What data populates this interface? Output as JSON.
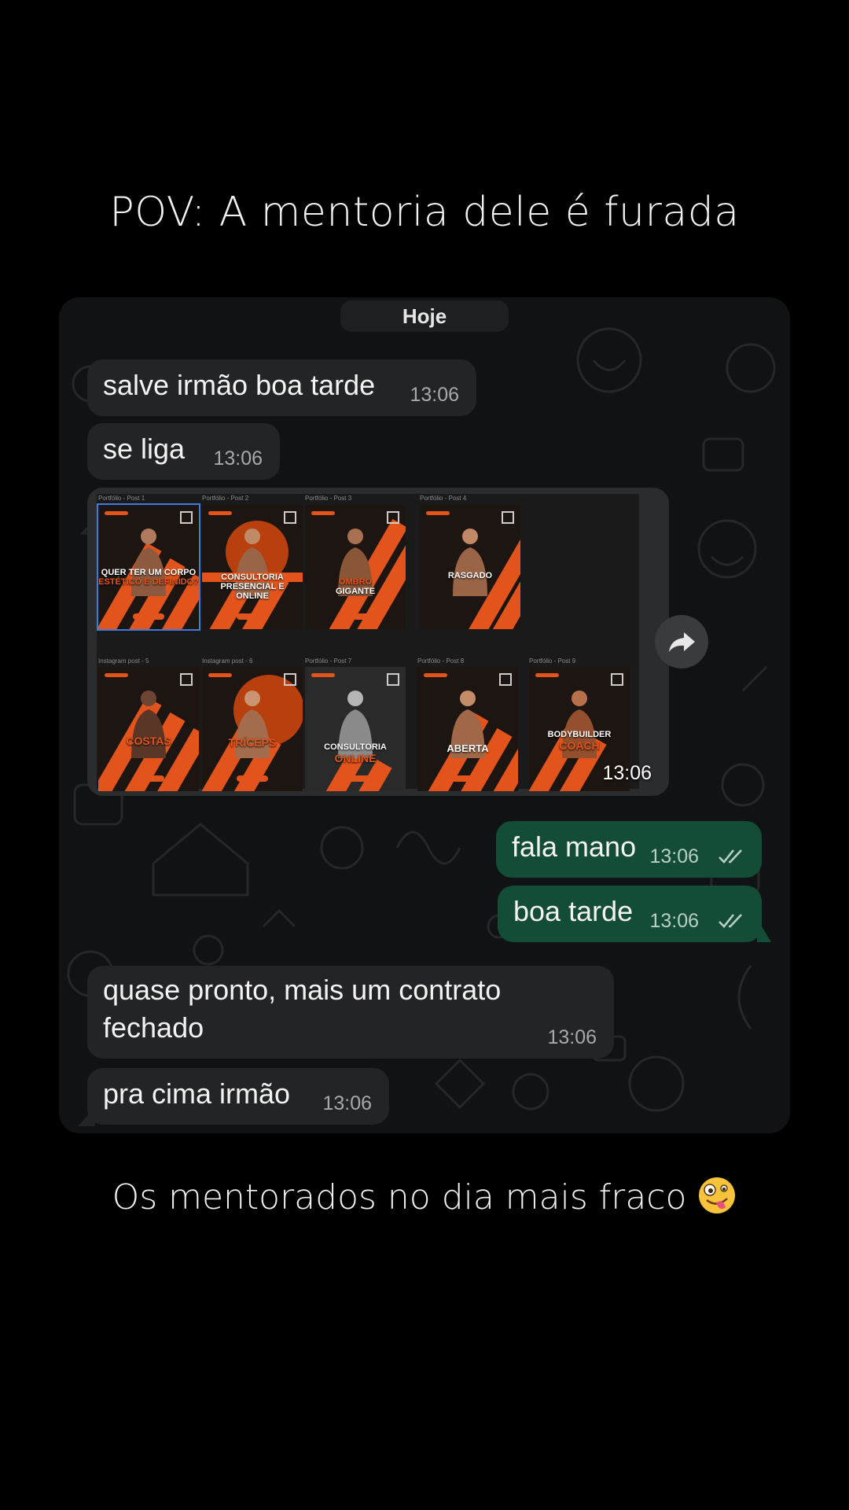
{
  "captions": {
    "top": "POV: A mentoria dele é furada",
    "bottom": "Os mentorados no dia mais fraco"
  },
  "chat": {
    "day_label": "Hoje",
    "messages": [
      {
        "direction": "in",
        "text": "salve irmão boa tarde",
        "time": "13:06"
      },
      {
        "direction": "in",
        "text": "se liga",
        "time": "13:06"
      },
      {
        "direction": "in",
        "type": "image",
        "time": "13:06"
      },
      {
        "direction": "out",
        "text": "fala mano",
        "time": "13:06",
        "status": "read"
      },
      {
        "direction": "out",
        "text": "boa tarde",
        "time": "13:06",
        "status": "read"
      },
      {
        "direction": "in",
        "text_line1": "quase pronto, mais um contrato",
        "text_line2": "fechado",
        "time": "13:06"
      },
      {
        "direction": "in",
        "text": "pra cima irmão",
        "time": "13:06"
      }
    ],
    "image": {
      "posts": [
        {
          "label": "Portfólio - Post 1",
          "title_line1": "QUER TER UM CORPO",
          "title_line2": "ESTÉTICO E DEFINIDO?"
        },
        {
          "label": "Portfólio - Post 2",
          "title_line1": "CONSULTORIA",
          "title_line2": "PRESENCIAL E",
          "title_line3": "ONLINE"
        },
        {
          "label": "Portfólio - Post 3",
          "title_line1": "OMBRO",
          "title_line2": "GIGANTE"
        },
        {
          "label": "Portfólio - Post 4",
          "title_line1": "RASGADO"
        },
        {
          "label": "Instagram post - 5",
          "title_line1": "COSTAS"
        },
        {
          "label": "Instagram post - 6",
          "title_line1": "TRÍCEPS"
        },
        {
          "label": "Portfólio - Post 7",
          "title_line1": "CONSULTORIA",
          "title_line2": "ONLINE"
        },
        {
          "label": "Portfólio - Post 8",
          "title_line1": "ABERTA"
        },
        {
          "label": "Portfólio - Post 9",
          "title_line1": "BODYBUILDER",
          "title_line2": "COACH"
        }
      ]
    }
  },
  "colors": {
    "incoming_bubble": "#232425",
    "outgoing_bubble": "#144d37",
    "accent_orange": "#e2541c",
    "read_ticks": "#b9cfc4"
  },
  "icons": {
    "forward": "forward-arrow-icon",
    "read_status": "double-check-icon",
    "emoji": "zany-face-emoji"
  }
}
